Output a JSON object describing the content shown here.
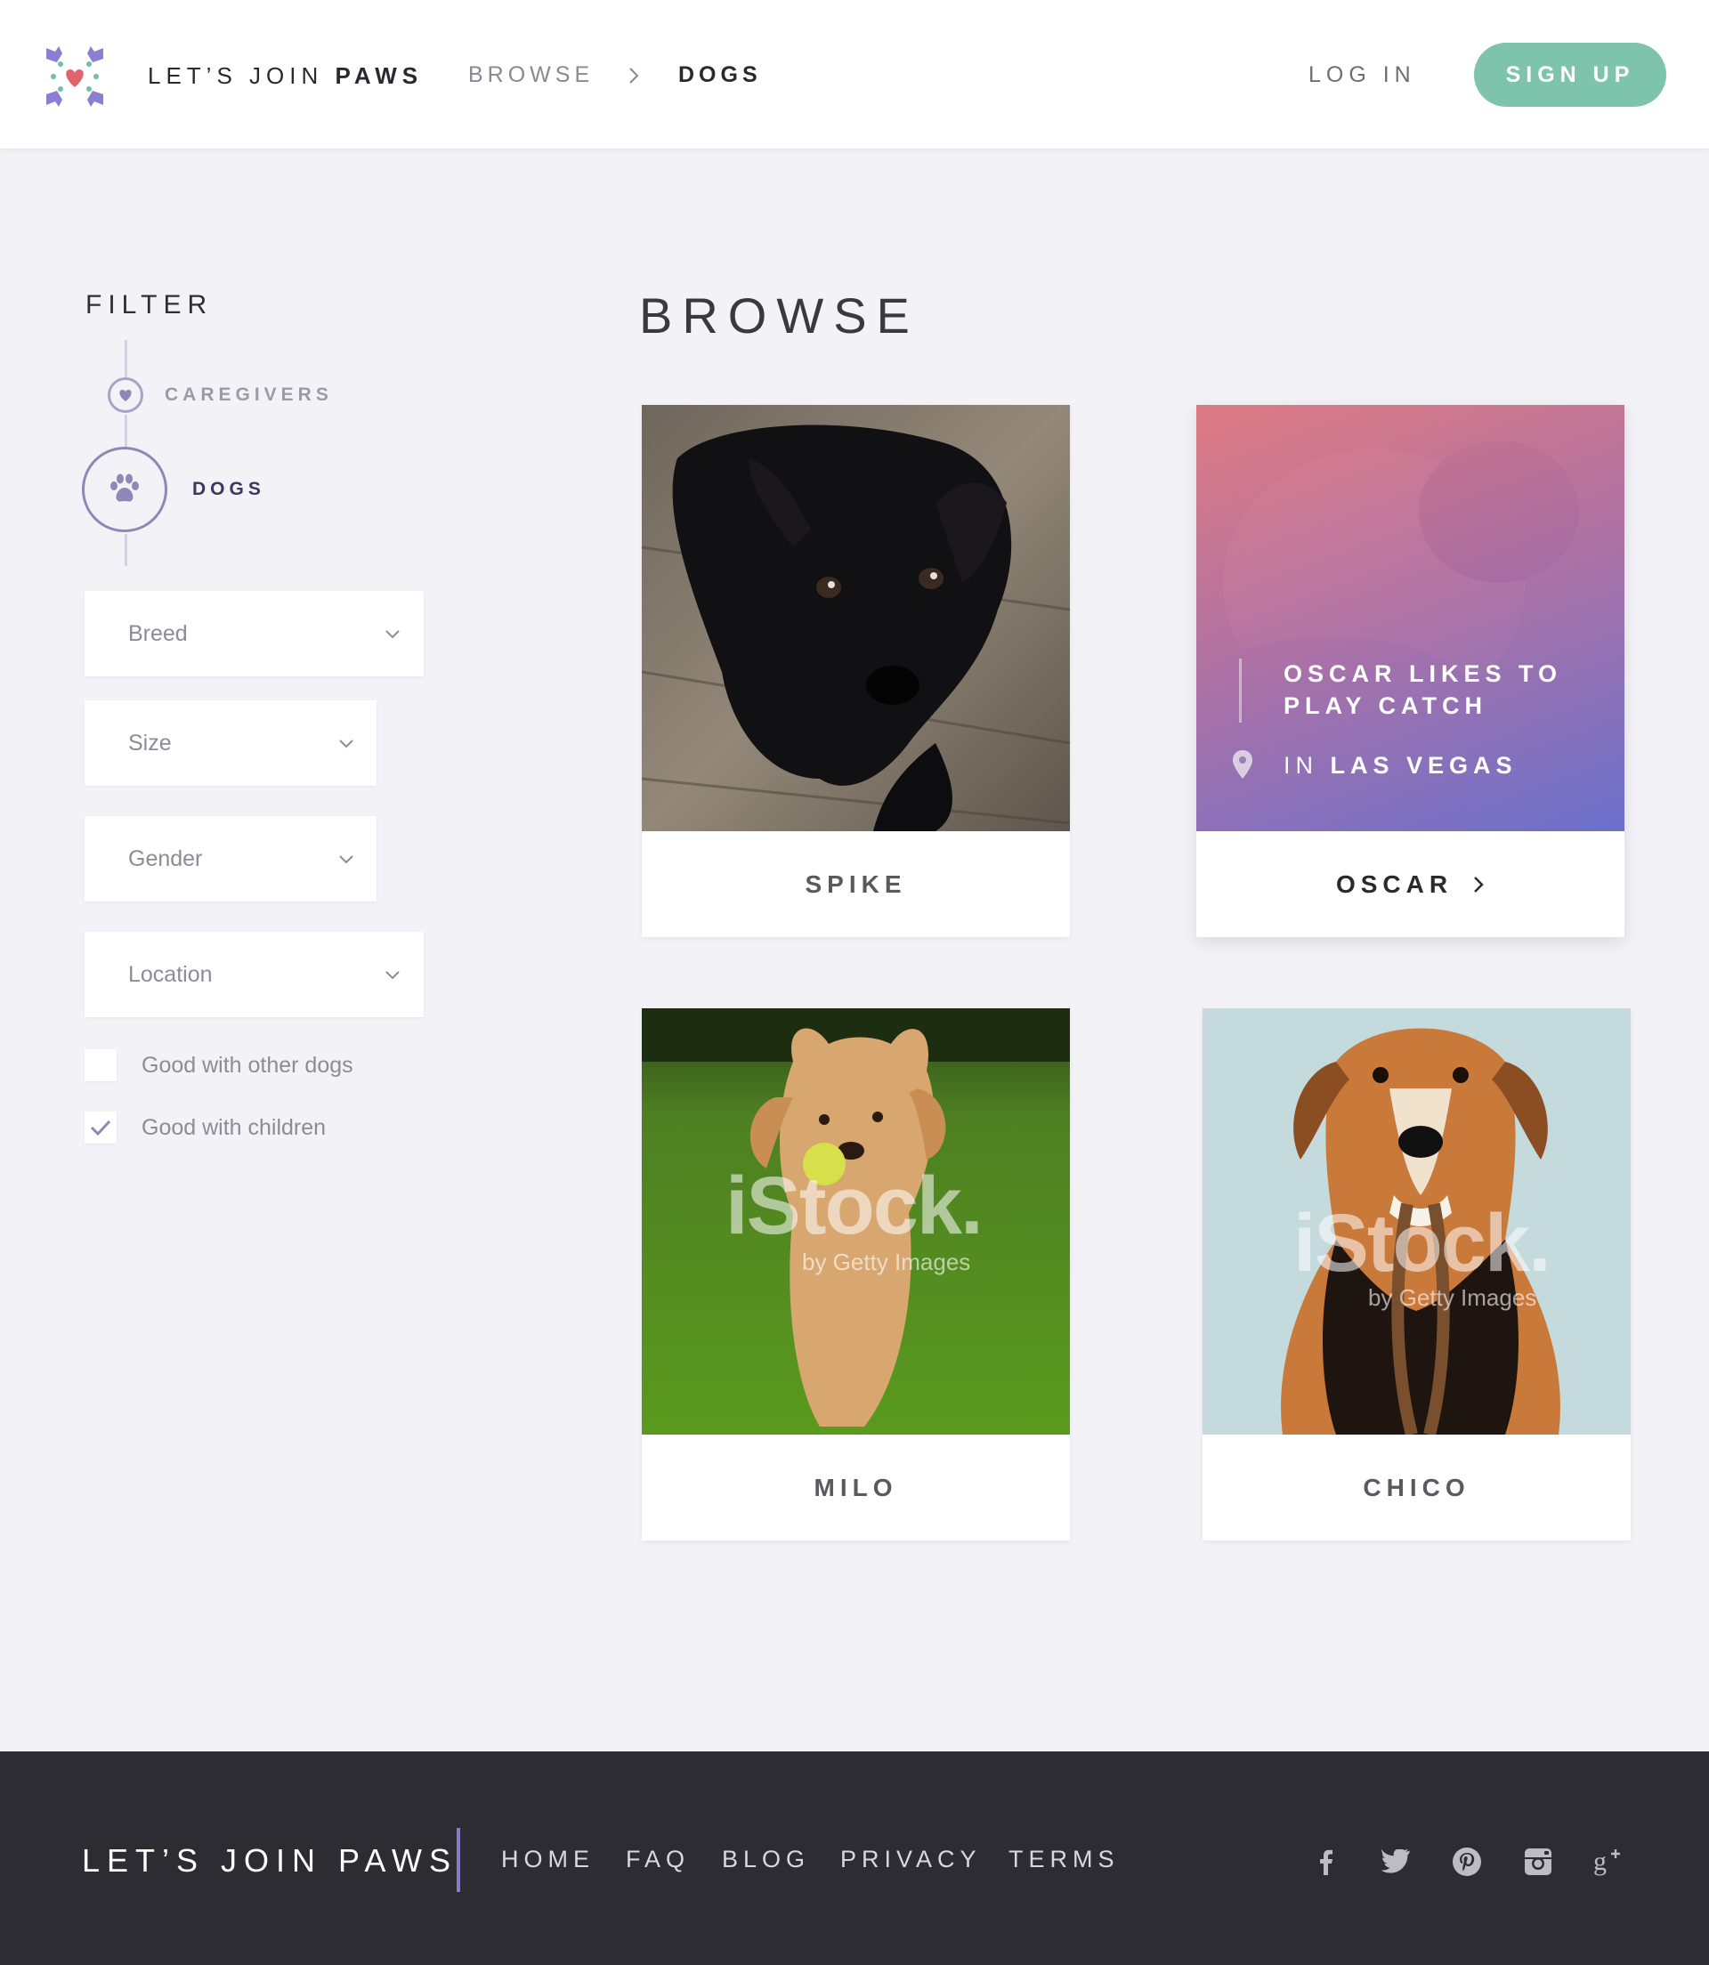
{
  "header": {
    "brand_prefix": "LET’S JOIN ",
    "brand_bold": "PAWS",
    "breadcrumb": [
      "BROWSE",
      "DOGS"
    ],
    "login_label": "LOG IN",
    "signup_label": "SIGN UP"
  },
  "sidebar": {
    "filter_title": "FILTER",
    "categories": [
      {
        "label": "CAREGIVERS",
        "icon": "heart-icon",
        "selected": false
      },
      {
        "label": "DOGS",
        "icon": "paw-icon",
        "selected": true
      }
    ],
    "dropdowns": [
      {
        "placeholder": "Breed"
      },
      {
        "placeholder": "Size"
      },
      {
        "placeholder": "Gender"
      },
      {
        "placeholder": "Location"
      }
    ],
    "checkboxes": [
      {
        "label": "Good with other dogs",
        "checked": false
      },
      {
        "label": "Good with children",
        "checked": true
      }
    ]
  },
  "main": {
    "title": "BROWSE",
    "cards": [
      {
        "name": "SPIKE",
        "image": "black-puppy-photo"
      },
      {
        "name": "OSCAR",
        "image": "dog-photo-with-overlay",
        "tagline": "OSCAR LIKES TO PLAY CATCH",
        "location_prefix": "IN",
        "location": "LAS VEGAS"
      },
      {
        "name": "MILO",
        "image": "golden-retriever-photo",
        "watermark": "iStock.",
        "watermark_sub": "by Getty Images"
      },
      {
        "name": "CHICO",
        "image": "beagle-mix-photo",
        "watermark": "iStock.",
        "watermark_sub": "by Getty Images"
      }
    ]
  },
  "footer": {
    "brand": "LET’S JOIN PAWS",
    "links": [
      "HOME",
      "FAQ",
      "BLOG",
      "PRIVACY",
      "TERMS"
    ],
    "social": [
      "facebook-icon",
      "twitter-icon",
      "pinterest-icon",
      "instagram-icon",
      "google-plus-icon"
    ]
  },
  "colors": {
    "accent": "#7ec4ad",
    "purple": "#8f88b6",
    "background": "#f3f2f7",
    "footer": "#2d2c33"
  }
}
